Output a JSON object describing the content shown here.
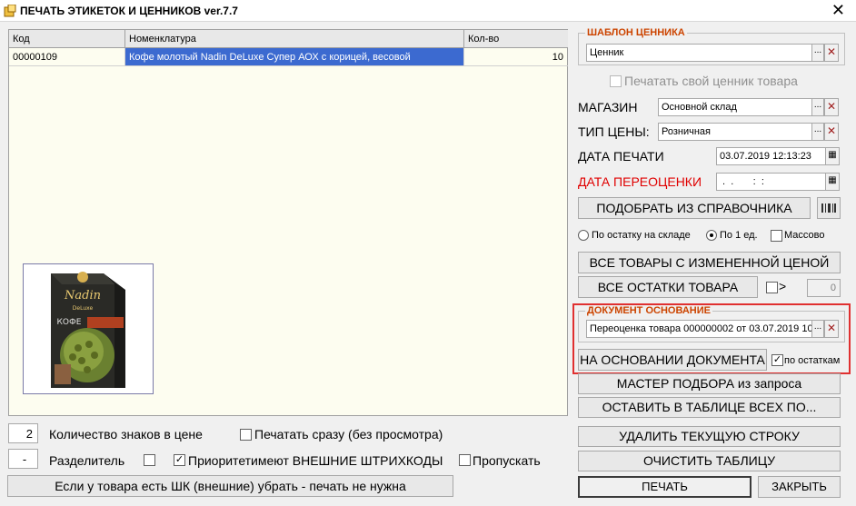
{
  "window": {
    "title": "ПЕЧАТЬ ЭТИКЕТОК И ЦЕННИКОВ ver.7.7",
    "close_glyph": "✕"
  },
  "table": {
    "columns": [
      "Код",
      "Номенклатура",
      "Кол-во"
    ],
    "rows": [
      {
        "code": "00000109",
        "name": "Кофе молотый Nadin DeLuxe Супер АОХ с корицей, весовой",
        "qty": "10"
      }
    ]
  },
  "product_image": {
    "brand": "Nadin",
    "sub": "DeLuxe",
    "word": "КОФЕ"
  },
  "bottom_left": {
    "price_digits_value": "2",
    "price_digits_label": "Количество знаков в цене",
    "print_now_label": "Печатать сразу (без просмотра)",
    "separator_value": "-",
    "separator_label": "Разделитель",
    "priority_barcodes_label": "Приоритетимеют ВНЕШНИЕ ШТРИХКОДЫ",
    "skip_label": "Пропускать",
    "remove_button": "Если у товара есть ШК (внешние) убрать - печать не нужна"
  },
  "right": {
    "template_title": "ШАБЛОН ЦЕННИКА",
    "template_value": "Ценник",
    "own_tag_label": "Печатать свой ценник товара",
    "store_label": "МАГАЗИН",
    "store_value": "Основной склад",
    "price_type_label": "ТИП ЦЕНЫ:",
    "price_type_value": "Розничная",
    "print_date_label": "ДАТА ПЕЧАТИ",
    "print_date_value": "03.07.2019 12:13:23",
    "reprice_date_label": "ДАТА ПЕРЕОЦЕНКИ",
    "reprice_date_value": " .  .       :  :",
    "pick_button": "ПОДОБРАТЬ ИЗ СПРАВОЧНИКА",
    "radio_stock": "По остатку на складе",
    "radio_one": "По 1 ед.",
    "mass_label": "Массово",
    "changed_price_button": "ВСЕ ТОВАРЫ С ИЗМЕНЕННОЙ ЦЕНОЙ",
    "all_stock_button": "ВСЕ ОСТАТКИ ТОВАРА",
    "gt_label": ">",
    "stock_threshold": "0",
    "doc_title": "ДОКУМЕНТ ОСНОВАНИЕ",
    "doc_value": "Переоценка товара 000000002 от 03.07.2019 10",
    "doc_button": "НА ОСНОВАНИИ ДОКУМЕНТА",
    "by_stock_label": "по остаткам",
    "wizard_button": "МАСТЕР ПОДБОРА из запроса",
    "keep_button": "ОСТАВИТЬ В ТАБЛИЦЕ ВСЕХ ПО...",
    "delete_button": "УДАЛИТЬ ТЕКУЩУЮ СТРОКУ",
    "clear_button": "ОЧИСТИТЬ ТАБЛИЦУ",
    "print_button": "ПЕЧАТЬ",
    "close_button": "ЗАКРЫТЬ"
  },
  "glyphs": {
    "ellipsis": "...",
    "clear": "✕",
    "check": "✓",
    "calendar": "▦"
  }
}
